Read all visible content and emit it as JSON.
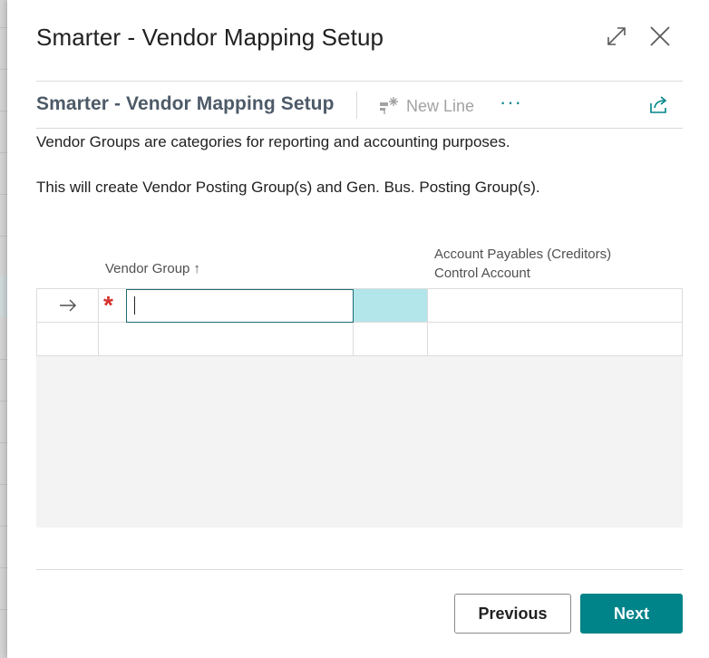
{
  "dialog": {
    "title": "Smarter - Vendor Mapping Setup",
    "expand_icon": "expand-icon",
    "close_icon": "close-icon"
  },
  "page": {
    "subtitle": "Smarter - Vendor Mapping Setup",
    "actions": {
      "new_line_label": "New Line",
      "new_line_icon": "new-line-icon",
      "more_label": "···",
      "share_icon": "share-icon"
    },
    "description_1": "Vendor Groups are categories for reporting and accounting purposes.",
    "description_2": "This will create Vendor Posting Group(s) and Gen. Bus. Posting Group(s)."
  },
  "grid": {
    "columns": {
      "vendor_group": "Vendor Group",
      "vendor_group_sort": "↑",
      "account_line1": "Account Payables (Creditors)",
      "account_line2": "Control Account"
    },
    "rows": [
      {
        "indicator": "→",
        "required_mark": "*",
        "vendor_group": "",
        "account": ""
      },
      {
        "indicator": "",
        "vendor_group": "",
        "account": ""
      }
    ]
  },
  "footer": {
    "previous_label": "Previous",
    "next_label": "Next"
  },
  "colors": {
    "accent": "#008489",
    "required": "#d6312c",
    "highlight_cell": "#b2e6ea",
    "subtitle": "#4d5a68"
  }
}
